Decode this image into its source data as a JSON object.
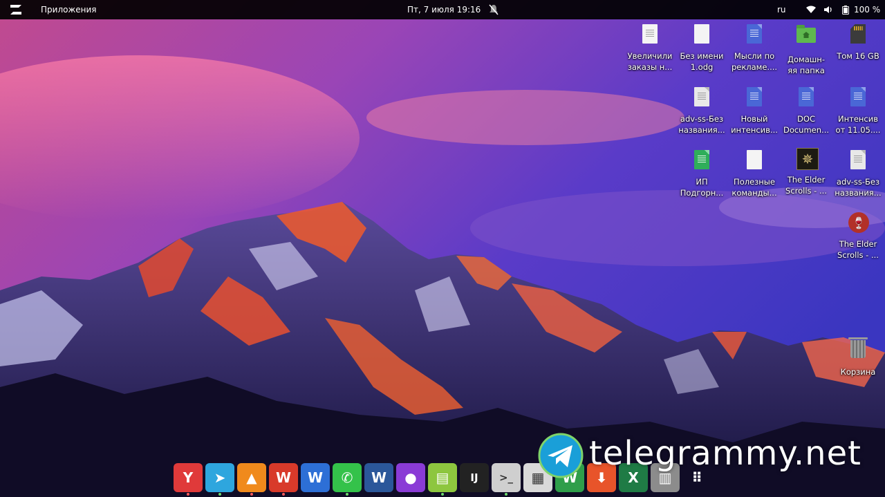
{
  "topbar": {
    "apps_label": "Приложения",
    "clock": "Пт, 7 июля  19:16",
    "lang": "ru",
    "battery": "100 %"
  },
  "desktop": {
    "icons": [
      {
        "label": "Увеличили\nзаказы н...",
        "icon": "document-thumbnail-icon"
      },
      {
        "label": "Без имени\n1.odg",
        "icon": "drawing-file-icon"
      },
      {
        "label": "Мысли по\nрекламе....",
        "icon": "text-document-icon"
      },
      {
        "label": "Домашн-\nяя папка",
        "icon": "home-folder-icon"
      },
      {
        "label": "Том 16 GB",
        "icon": "sd-card-icon"
      },
      {
        "label": "adv-ss-Без\nназвания...",
        "icon": "text-file-icon"
      },
      {
        "label": "Новый\nинтенсив...",
        "icon": "text-document-icon"
      },
      {
        "label": "DOC\nDocumen...",
        "icon": "text-document-icon"
      },
      {
        "label": "Интенсив\nот 11.05....",
        "icon": "text-document-icon"
      },
      {
        "label": "ИП\nПодгорн...",
        "icon": "spreadsheet-icon"
      },
      {
        "label": "Полезные\nкоманды...",
        "icon": "blank-file-icon"
      },
      {
        "label": "The Elder\nScrolls - ...",
        "icon": "game-launcher-icon"
      },
      {
        "label": "adv-ss-Без\nназвания...",
        "icon": "text-file-icon"
      },
      {
        "label": "The Elder\nScrolls - ...",
        "icon": "wine-icon"
      },
      {
        "label": "Корзина",
        "icon": "trash-icon"
      }
    ]
  },
  "dock": {
    "items": [
      {
        "name": "yandex-browser",
        "glyph": "Y",
        "color": "#e03a3a",
        "running": true
      },
      {
        "name": "telegram",
        "glyph": "➤",
        "color": "#2ea6de",
        "running": true
      },
      {
        "name": "vlc",
        "glyph": "▲",
        "color": "#f08a1c",
        "running": true
      },
      {
        "name": "wps-office",
        "glyph": "W",
        "color": "#d83a2a",
        "running": true
      },
      {
        "name": "wps-writer",
        "glyph": "W",
        "color": "#2d6fd6",
        "running": false
      },
      {
        "name": "phone",
        "glyph": "✆",
        "color": "#34c24a",
        "running": true
      },
      {
        "name": "word",
        "glyph": "W",
        "color": "#2b579a",
        "running": false
      },
      {
        "name": "color-picker",
        "glyph": "●",
        "color": "#8a3bd6",
        "running": false
      },
      {
        "name": "file-manager",
        "glyph": "▤",
        "color": "#8dc63f",
        "running": true
      },
      {
        "name": "intellij",
        "glyph": "IJ",
        "color": "#222222",
        "running": false
      },
      {
        "name": "terminal",
        "glyph": ">_",
        "color": "#cfcfcf",
        "running": true
      },
      {
        "name": "calculator",
        "glyph": "▦",
        "color": "#d9d9d9",
        "running": false
      },
      {
        "name": "sheets",
        "glyph": "W",
        "color": "#2f9e4a",
        "running": false
      },
      {
        "name": "downloader",
        "glyph": "⬇",
        "color": "#e8542a",
        "running": false
      },
      {
        "name": "excel",
        "glyph": "X",
        "color": "#1f7b45",
        "running": false
      },
      {
        "name": "trash",
        "glyph": "▥",
        "color": "#8c8c8c",
        "running": false
      },
      {
        "name": "app-grid",
        "glyph": "⠿",
        "color": "transparent",
        "running": false
      }
    ]
  },
  "watermark": {
    "text": "telegrammy.net"
  }
}
